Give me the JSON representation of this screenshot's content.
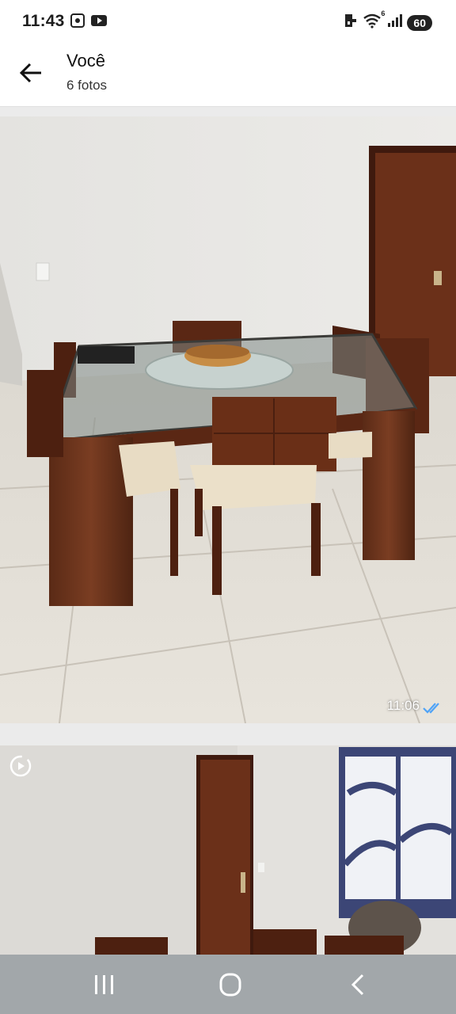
{
  "status_bar": {
    "time": "11:43",
    "left_icons": [
      "screenshot-icon",
      "youtube-icon"
    ],
    "right_icons": [
      "vpn-key-icon",
      "wifi-icon",
      "signal-icon"
    ],
    "wifi_label": "6",
    "battery": "60"
  },
  "header": {
    "title": "Você",
    "subtitle": "6 fotos"
  },
  "photos": [
    {
      "time": "11:06",
      "status_icon": "double-check-icon",
      "read_color": "#4fa3f7"
    },
    {
      "badge_icon": "video-play-icon"
    }
  ],
  "nav_bar": {
    "buttons": [
      "recent-apps-icon",
      "home-icon",
      "back-icon"
    ]
  }
}
